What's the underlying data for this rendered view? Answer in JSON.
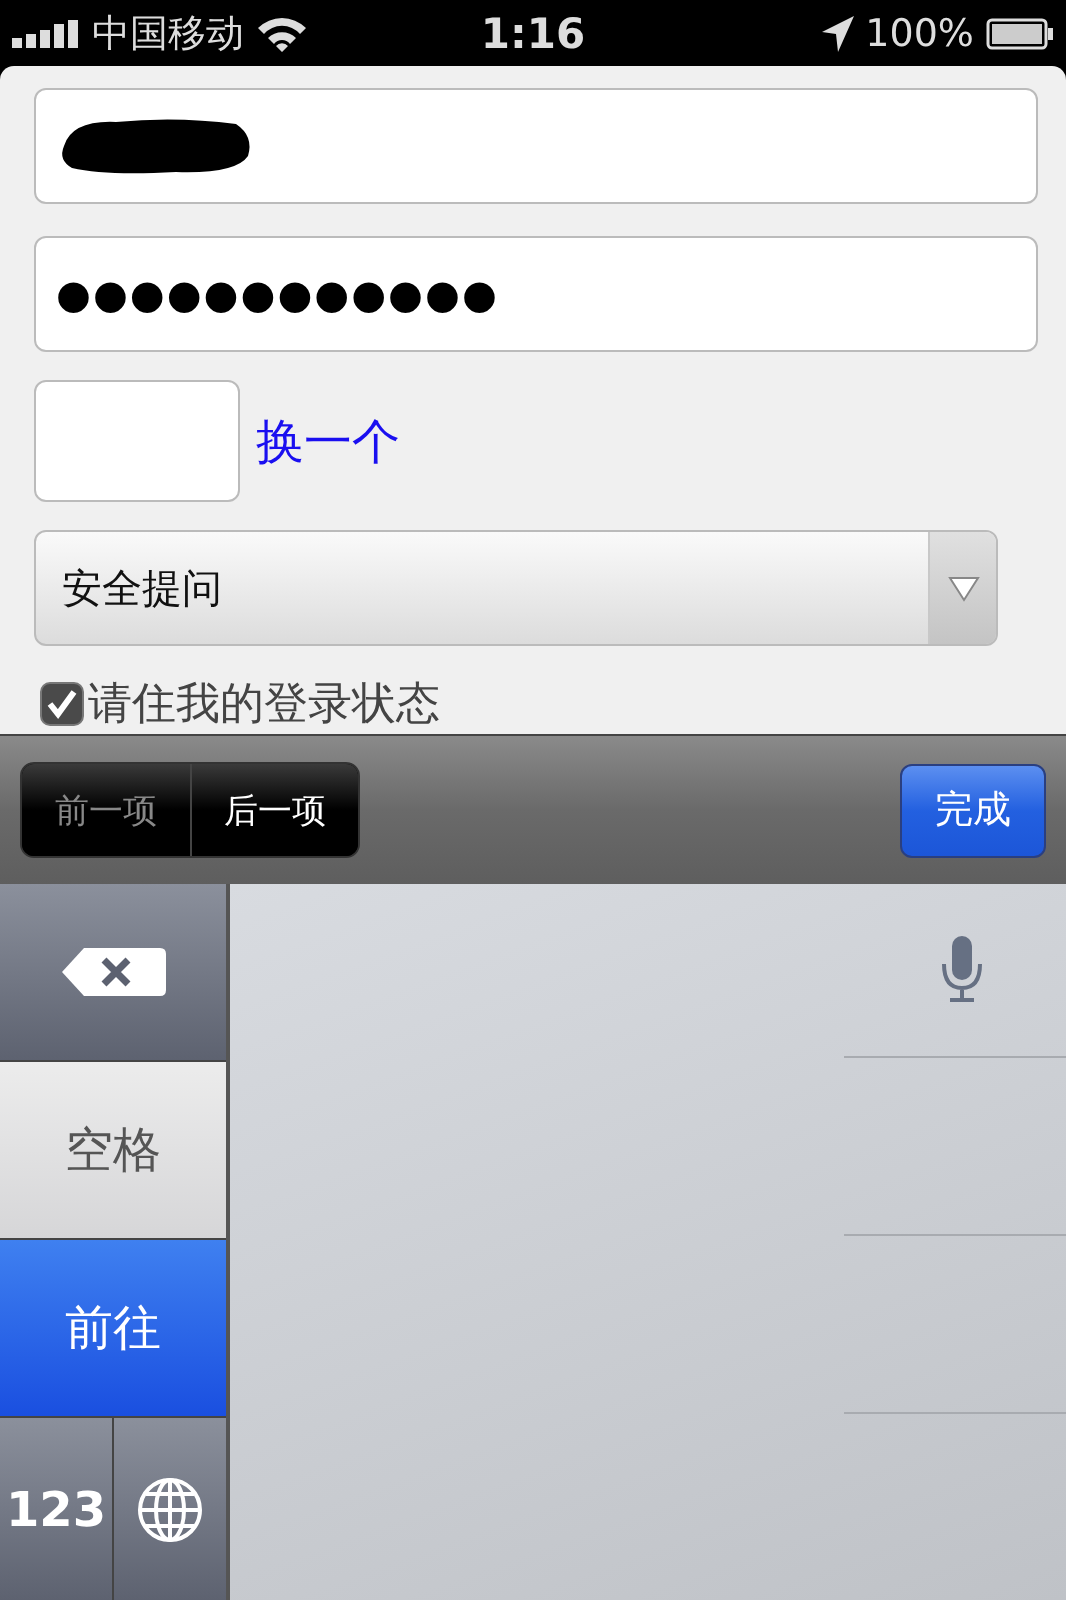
{
  "status_bar": {
    "carrier": "中国移动",
    "time": "1:16",
    "battery": "100%"
  },
  "form": {
    "username": {
      "redacted": true
    },
    "password": {
      "value": "●●●●●●●●●●●●"
    },
    "captcha": {
      "refresh_link": "换一个"
    },
    "select": {
      "value": "安全提问"
    },
    "remember": {
      "label": "请住我的登录状态",
      "checked": true
    }
  },
  "toolbar": {
    "nav": [
      {
        "label": "前一项",
        "disabled": true
      },
      {
        "label": "后一项",
        "disabled": false
      }
    ],
    "done": "完成"
  },
  "keyboard": {
    "keys": [
      {
        "kind": "delete"
      },
      {
        "kind": "text",
        "label": "空格"
      },
      {
        "kind": "action",
        "label": "前往"
      },
      {
        "kind": "number",
        "label": "123"
      },
      {
        "kind": "globe"
      }
    ]
  }
}
